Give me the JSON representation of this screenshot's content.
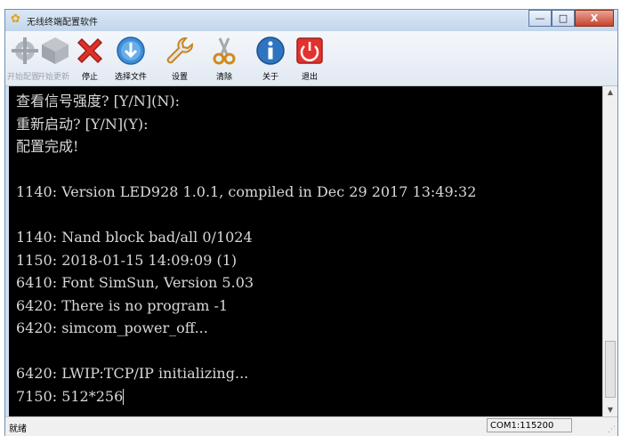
{
  "window": {
    "title": "无线终端配置软件"
  },
  "window_buttons": {
    "minimize": "—",
    "maximize": "□",
    "close": "X"
  },
  "toolbar": {
    "items": [
      {
        "label": "开始配置",
        "icon": "gear-wrench-icon",
        "enabled": false
      },
      {
        "label": "开始更新",
        "icon": "box-update-icon",
        "enabled": false
      },
      {
        "label": "停止",
        "icon": "red-x-icon",
        "enabled": true
      },
      {
        "label": "选择文件",
        "icon": "blue-download-icon",
        "enabled": true
      },
      {
        "label": "设置",
        "icon": "wrench-icon",
        "enabled": true
      },
      {
        "label": "清除",
        "icon": "scissors-icon",
        "enabled": true
      },
      {
        "label": "关于",
        "icon": "info-icon",
        "enabled": true
      },
      {
        "label": "退出",
        "icon": "power-icon",
        "enabled": true
      }
    ]
  },
  "terminal": {
    "lines": [
      "查看信号强度? [Y/N](N):",
      "重新启动? [Y/N](Y):",
      "配置完成!",
      "",
      "1140: Version LED928 1.0.1, compiled in Dec 29 2017 13:49:32",
      "",
      "1140: Nand block bad/all 0/1024",
      "1150: 2018-01-15 14:09:09 (1)",
      "6410: Font SimSun, Version 5.03",
      "6420: There is no program -1",
      "6420: simcom_power_off...",
      "",
      "6420: LWIP:TCP/IP initializing...",
      "7150: 512*256"
    ]
  },
  "status": {
    "left": "就绪",
    "port": "COM1:115200"
  },
  "colors": {
    "terminal_bg": "#000000",
    "terminal_fg": "#d8d8d8",
    "titlebar": "#c3d6ec",
    "close": "#c8432c"
  }
}
